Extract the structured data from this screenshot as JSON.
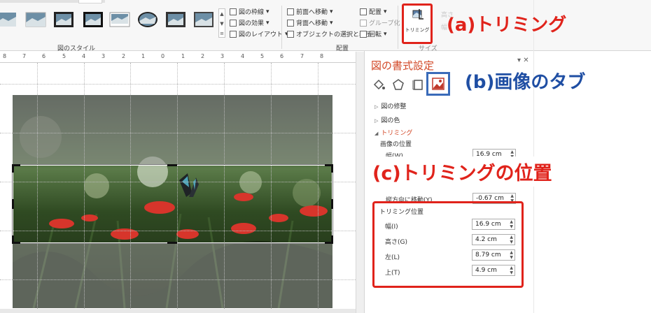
{
  "ribbon": {
    "picture_styles_label": "図のスタイル",
    "arrange_label": "配置",
    "size_label": "サイズ",
    "style_commands": [
      {
        "label": "図の枠線",
        "icon": "picture-border-icon"
      },
      {
        "label": "図の効果",
        "icon": "picture-effects-icon"
      },
      {
        "label": "図のレイアウト",
        "icon": "picture-layout-icon"
      }
    ],
    "arrange_commands": [
      {
        "label": "前面へ移動",
        "icon": "bring-forward-icon"
      },
      {
        "label": "背面へ移動",
        "icon": "send-backward-icon"
      },
      {
        "label": "オブジェクトの選択と表示",
        "icon": "selection-pane-icon"
      },
      {
        "label": "配置",
        "icon": "align-icon"
      },
      {
        "label": "グループ化",
        "icon": "group-icon"
      },
      {
        "label": "回転",
        "icon": "rotate-icon"
      }
    ],
    "trim_button_label": "トリミング",
    "size_ghost_labels": [
      "高さ",
      "幅"
    ]
  },
  "ruler": {
    "marks": [
      "8",
      "7",
      "6",
      "5",
      "4",
      "3",
      "2",
      "1",
      "0",
      "1",
      "2",
      "3",
      "4",
      "5",
      "6",
      "7",
      "8"
    ]
  },
  "annotations": {
    "a": "(a)トリミング",
    "b": "(b)画像のタブ",
    "c": "(c)トリミングの位置"
  },
  "pane": {
    "title": "図の書式設定",
    "close_label": "▾ ✕",
    "tabs": [
      "fill-line-icon",
      "effects-icon",
      "size-properties-icon",
      "picture-icon"
    ],
    "sections": [
      {
        "label": "図の修整",
        "expanded": false
      },
      {
        "label": "図の色",
        "expanded": false
      },
      {
        "label": "トリミング",
        "expanded": true
      }
    ],
    "image_position_label": "画像の位置",
    "image_position": {
      "width_label": "幅(W)",
      "width_value": "16.9 cm",
      "offset_y_label": "縦方向に移動(Y)",
      "offset_y_value": "-0.67 cm"
    },
    "crop_position_label": "トリミング位置",
    "crop_position": [
      {
        "label": "幅(I)",
        "value": "16.9 cm"
      },
      {
        "label": "高さ(G)",
        "value": "4.2 cm"
      },
      {
        "label": "左(L)",
        "value": "8.79 cm"
      },
      {
        "label": "上(T)",
        "value": "4.9 cm"
      }
    ]
  },
  "colors": {
    "accent_red": "#e0231b",
    "accent_blue": "#1f4ea3",
    "pane_title": "#d24726"
  }
}
